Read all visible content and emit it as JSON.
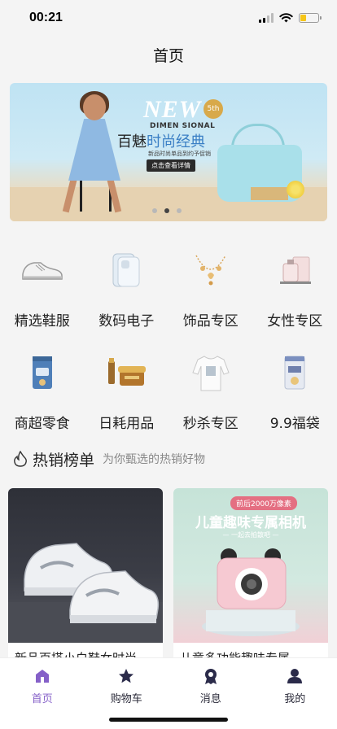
{
  "status_bar": {
    "time": "00:21",
    "battery_level": 0.35,
    "battery_color": "#f5c518"
  },
  "header": {
    "title": "首页"
  },
  "banner": {
    "new_text": "NEW",
    "badge": "5th",
    "sub_en": "DIMEN SIONAL",
    "headline_prefix": "百魅",
    "headline_highlight": "时尚经典",
    "sub_cn": "新品时尚单品到约予促销",
    "cta": "点击查看详情",
    "dots_count": 3,
    "active_dot": 1
  },
  "categories": [
    {
      "label": "精选鞋服",
      "icon": "sneaker-icon"
    },
    {
      "label": "数码电子",
      "icon": "phone-case-icon"
    },
    {
      "label": "饰品专区",
      "icon": "necklace-icon"
    },
    {
      "label": "女性专区",
      "icon": "perfume-icon"
    },
    {
      "label": "商超零食",
      "icon": "snack-bag-icon"
    },
    {
      "label": "日耗用品",
      "icon": "cream-jar-icon"
    },
    {
      "label": "秒杀专区",
      "icon": "tshirt-icon"
    },
    {
      "label": "9.9福袋",
      "icon": "gift-bag-icon"
    }
  ],
  "hot_section": {
    "title": "热销榜单",
    "subtitle": "为你甄选的热销好物",
    "icon": "flame-icon"
  },
  "products": [
    {
      "name": "新品百搭小白鞋女时尚",
      "image": "sneakers-image"
    },
    {
      "name": "儿童多功能趣味专属",
      "image": "kids-camera-image",
      "tag": "前后2000万像素",
      "banner_title": "儿童趣味专属相机",
      "banner_sub": "— 一起去拍散吧 —"
    }
  ],
  "tab_bar": [
    {
      "label": "首页",
      "icon": "home-icon",
      "active": true
    },
    {
      "label": "购物车",
      "icon": "star-icon",
      "active": false
    },
    {
      "label": "消息",
      "icon": "badge-icon",
      "active": false
    },
    {
      "label": "我的",
      "icon": "user-icon",
      "active": false
    }
  ],
  "colors": {
    "accent": "#8560c8",
    "page_bg": "#f4f4f4"
  }
}
